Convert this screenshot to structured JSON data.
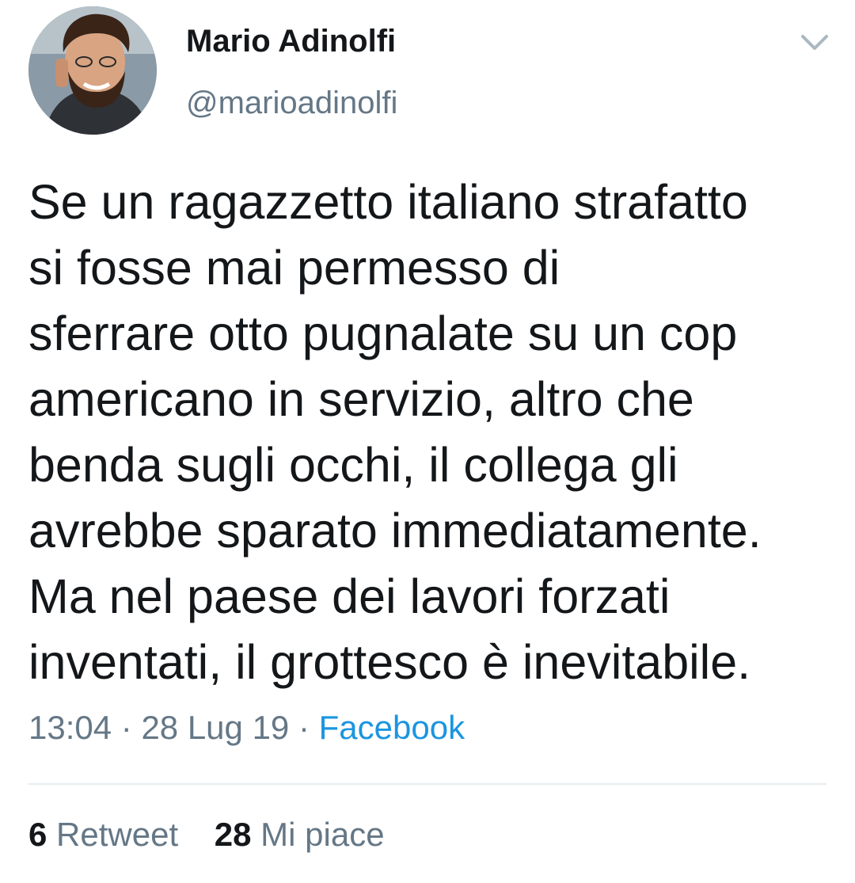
{
  "user": {
    "display_name": "Mario Adinolfi",
    "handle": "@marioadinolfi",
    "avatar_icon": "profile-photo"
  },
  "header": {
    "caret_icon": "chevron-down-icon"
  },
  "tweet": {
    "text": "Se un ragazzetto italiano strafatto\nsi fosse mai permesso di\nsferrare otto pugnalate su un cop\namericano in servizio, altro che\nbenda sugli occhi, il collega gli\navrebbe sparato immediatamente.\nMa nel paese dei lavori forzati\ninventati, il grottesco è inevitabile.",
    "time": "13:04",
    "separator": " · ",
    "date": "28 Lug 19",
    "source": "Facebook"
  },
  "stats": {
    "retweets_count": "6",
    "retweets_label": "Retweet",
    "likes_count": "28",
    "likes_label": "Mi piace"
  },
  "colors": {
    "text": "#14171a",
    "secondary": "#657786",
    "link": "#1b95e0",
    "divider": "#e6ecf0"
  }
}
